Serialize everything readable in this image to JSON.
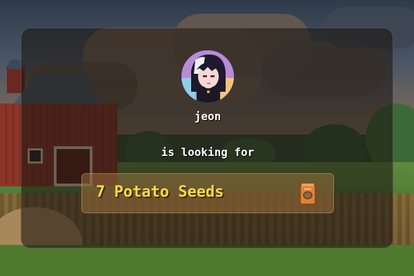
{
  "user": {
    "name": "jeon"
  },
  "message": {
    "prefix": "is looking for"
  },
  "request": {
    "label": "7 Potato Seeds",
    "quantity": 7,
    "item": "Potato Seeds",
    "icon": "seed-packet-icon"
  },
  "colors": {
    "highlight_text": "#ffd84a",
    "body_text": "#ffffff",
    "request_panel": "#96703c"
  }
}
